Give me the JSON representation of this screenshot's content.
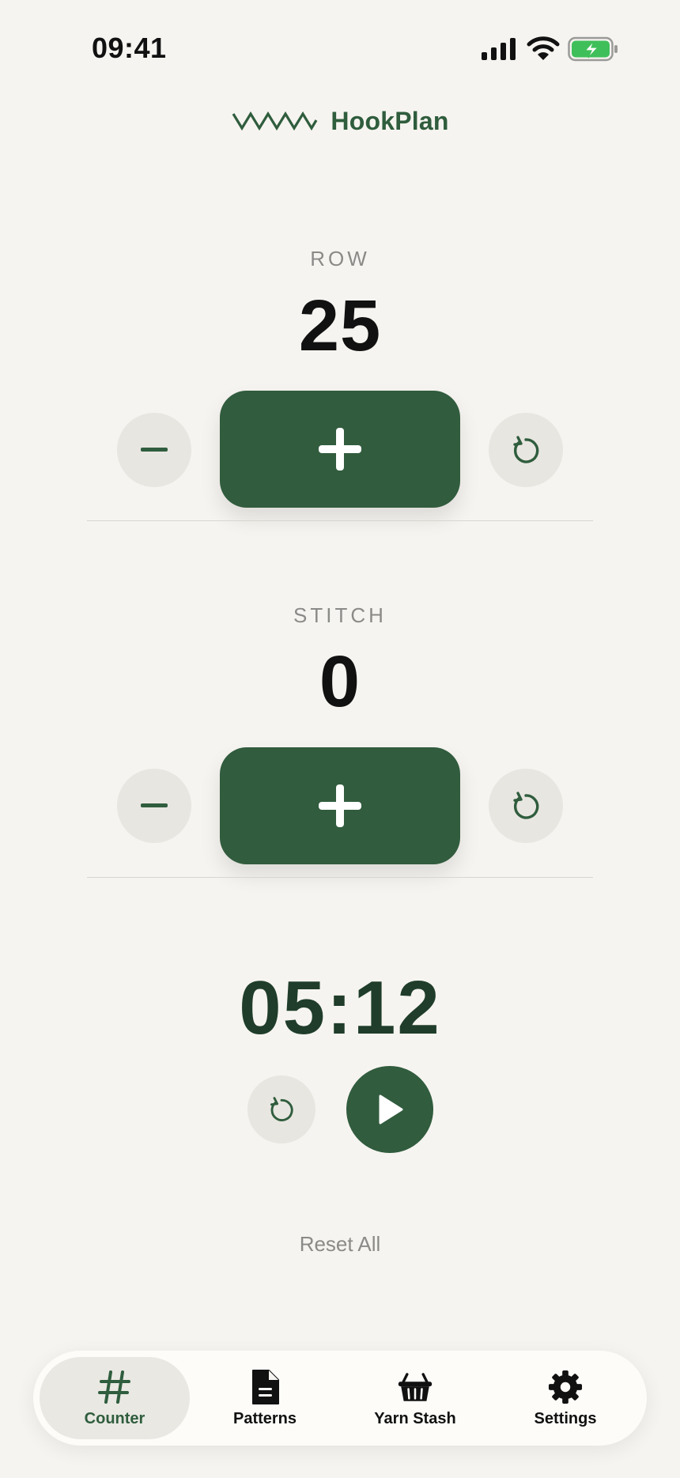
{
  "status_bar": {
    "time": "09:41"
  },
  "header": {
    "title": "HookPlan"
  },
  "row_counter": {
    "label": "ROW",
    "value": "25"
  },
  "stitch_counter": {
    "label": "STITCH",
    "value": "0"
  },
  "timer": {
    "value": "05:12"
  },
  "reset_all_label": "Reset All",
  "tabs": [
    {
      "label": "Counter",
      "icon": "hash-icon",
      "active": true
    },
    {
      "label": "Patterns",
      "icon": "document-icon",
      "active": false
    },
    {
      "label": "Yarn Stash",
      "icon": "basket-icon",
      "active": false
    },
    {
      "label": "Settings",
      "icon": "gear-icon",
      "active": false
    }
  ],
  "colors": {
    "accent": "#315c3e",
    "background": "#f6f4f0",
    "muted": "#8a8a88",
    "button_bg": "#e8e6e1"
  }
}
